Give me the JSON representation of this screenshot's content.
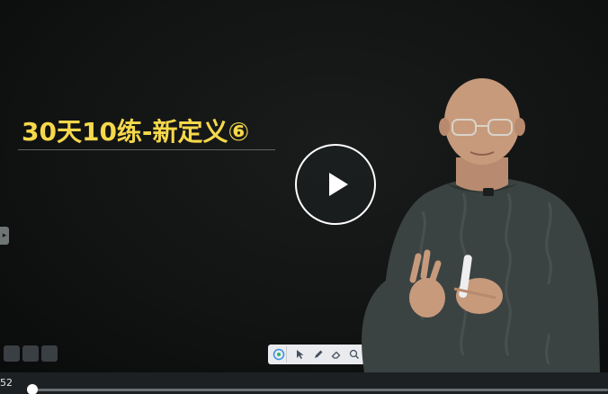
{
  "video": {
    "title": "30天10练-新定义⑥"
  },
  "player": {
    "time_display": "52",
    "progress": 0.01,
    "play_icon": "play-icon"
  },
  "toolbar": {
    "tools": [
      "whiteboard-icon",
      "cursor-icon",
      "pen-icon",
      "eraser-icon",
      "zoom-icon",
      "screen-icon"
    ]
  },
  "colors": {
    "title": "#f6d84a",
    "background": "#121414",
    "control_bar": "#1d2022"
  }
}
